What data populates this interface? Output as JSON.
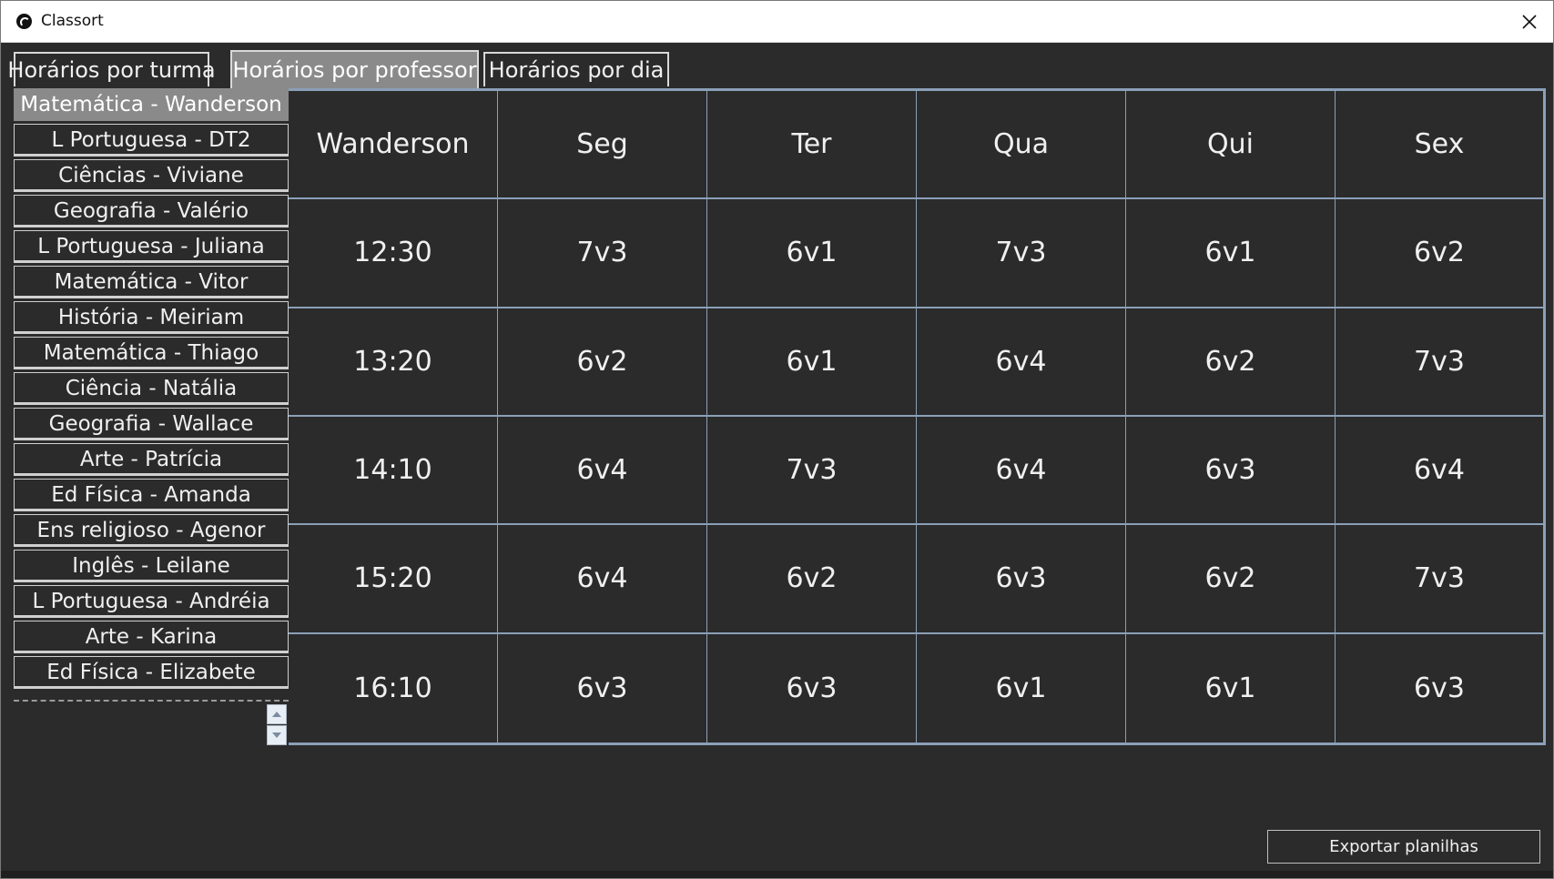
{
  "window": {
    "title": "Classort"
  },
  "tabs": [
    {
      "label": "Horários por turma",
      "active": false
    },
    {
      "label": "Horários por professor",
      "active": true
    },
    {
      "label": "Horários por dia",
      "active": false
    }
  ],
  "teachers": [
    "Matemática - Wanderson",
    "L Portuguesa - DT2",
    "Ciências - Viviane",
    "Geografia - Valério",
    "L Portuguesa - Juliana",
    "Matemática - Vitor",
    "História - Meiriam",
    "Matemática - Thiago",
    "Ciência  - Natália",
    "Geografia - Wallace",
    "Arte - Patrícia",
    "Ed Física - Amanda",
    "Ens religioso - Agenor",
    "Inglês - Leilane",
    "L Portuguesa - Andréia",
    "Arte - Karina",
    "Ed Física - Elizabete"
  ],
  "selected_teacher_index": 0,
  "schedule": {
    "header": [
      "Wanderson",
      "Seg",
      "Ter",
      "Qua",
      "Qui",
      "Sex"
    ],
    "rows": [
      [
        "12:30",
        "7v3",
        "6v1",
        "7v3",
        "6v1",
        "6v2"
      ],
      [
        "13:20",
        "6v2",
        "6v1",
        "6v4",
        "6v2",
        "7v3"
      ],
      [
        "14:10",
        "6v4",
        "7v3",
        "6v4",
        "6v3",
        "6v4"
      ],
      [
        "15:20",
        "6v4",
        "6v2",
        "6v3",
        "6v2",
        "7v3"
      ],
      [
        "16:10",
        "6v3",
        "6v3",
        "6v1",
        "6v1",
        "6v3"
      ]
    ]
  },
  "export_button": {
    "label": "Exportar planilhas"
  },
  "colors": {
    "background": "#2b2b2b",
    "selected": "#8a8a8a",
    "grid_line": "#8ba0b8",
    "text": "#f0f0f0"
  }
}
